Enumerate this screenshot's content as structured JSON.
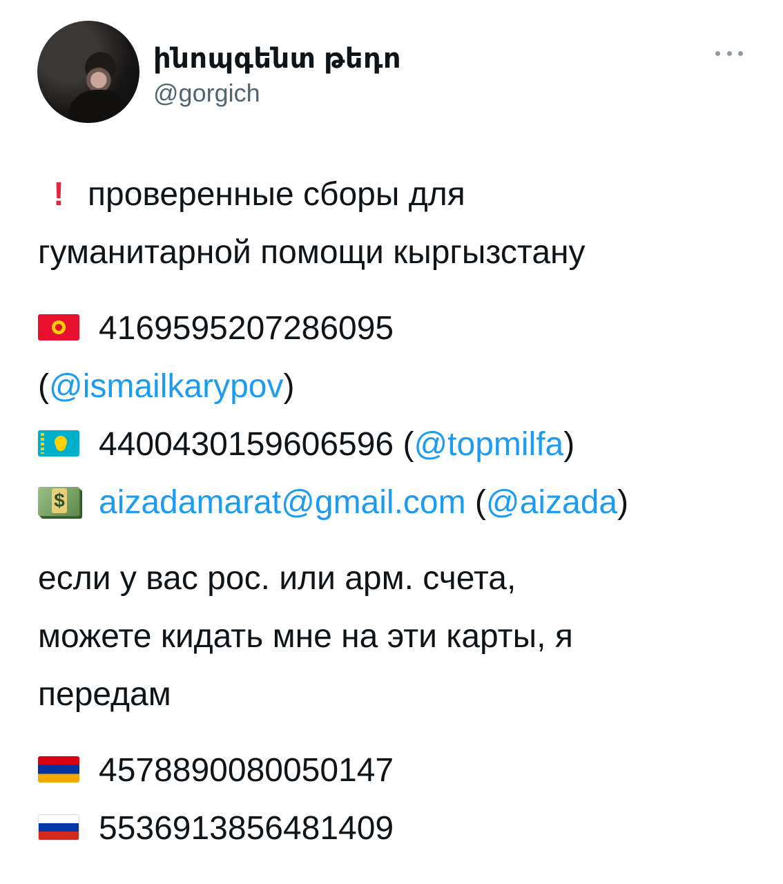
{
  "author": {
    "display_name": "ինոպգենտ թեդո",
    "handle": "@gorgich"
  },
  "tweet": {
    "intro_line1": "проверенные сборы для",
    "intro_line2": "гуманитарной помощи кыргызстану",
    "card_kg": "4169595207286095",
    "card_kg_link": "@ismailkarypov",
    "card_kz": "4400430159606596",
    "card_kz_link": "@topmilfa",
    "email": "aizadamarat@gmail.com",
    "email_link": "@aizada",
    "note_line1": "если у вас рос. или арм. счета,",
    "note_line2": "можете кидать мне на эти карты, я",
    "note_line3": "передам",
    "card_am": "4578890080050147",
    "card_ru": "5536913856481409"
  },
  "icons": {
    "exclamation": "heavy-exclamation-mark-icon",
    "kg": "kyrgyzstan-flag-icon",
    "kz": "kazakhstan-flag-icon",
    "money": "dollar-banknote-icon",
    "am": "armenia-flag-icon",
    "ru": "russia-flag-icon"
  },
  "colors": {
    "link": "#1d9bf0",
    "text": "#0f1419",
    "muted": "#536471"
  }
}
